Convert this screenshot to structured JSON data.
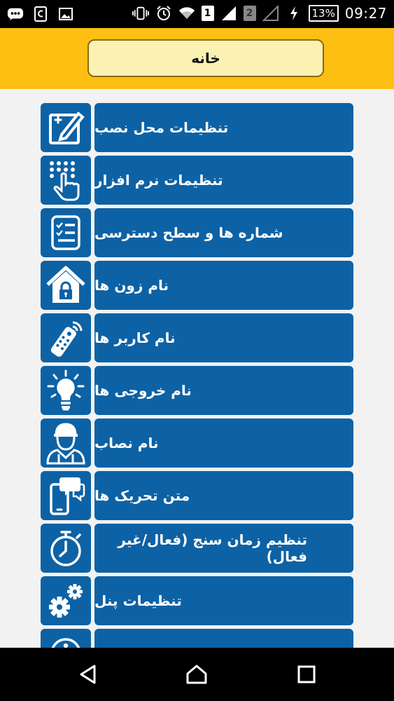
{
  "status_bar": {
    "battery": "13%",
    "time": "09:27",
    "sim1": "1",
    "sim2": "2"
  },
  "header": {
    "home_label": "خانه"
  },
  "menu": {
    "items": [
      {
        "label": "تنظیمات محل نصب",
        "icon": "edit-note-icon"
      },
      {
        "label": "تنظیمات نرم افزار",
        "icon": "keypad-touch-icon"
      },
      {
        "label": "شماره ها و سطح دسترسی",
        "icon": "checklist-icon"
      },
      {
        "label": "نام زون ها",
        "icon": "house-lock-icon"
      },
      {
        "label": "نام کاربر ها",
        "icon": "remote-control-icon"
      },
      {
        "label": "نام خروجی ها",
        "icon": "light-bulb-icon"
      },
      {
        "label": "نام نصاب",
        "icon": "installer-worker-icon"
      },
      {
        "label": "متن تحریک ها",
        "icon": "phone-message-icon"
      },
      {
        "label": "تنظیم زمان سنج (فعال/غیر فعال)",
        "icon": "stopwatch-icon"
      },
      {
        "label": "تنظیمات پنل",
        "icon": "gears-icon"
      },
      {
        "label": "",
        "icon": "info-icon"
      }
    ]
  },
  "colors": {
    "accent_blue": "#0d62a5",
    "header_yellow": "#fcbf12",
    "home_button_fill": "#fbf1b3"
  }
}
